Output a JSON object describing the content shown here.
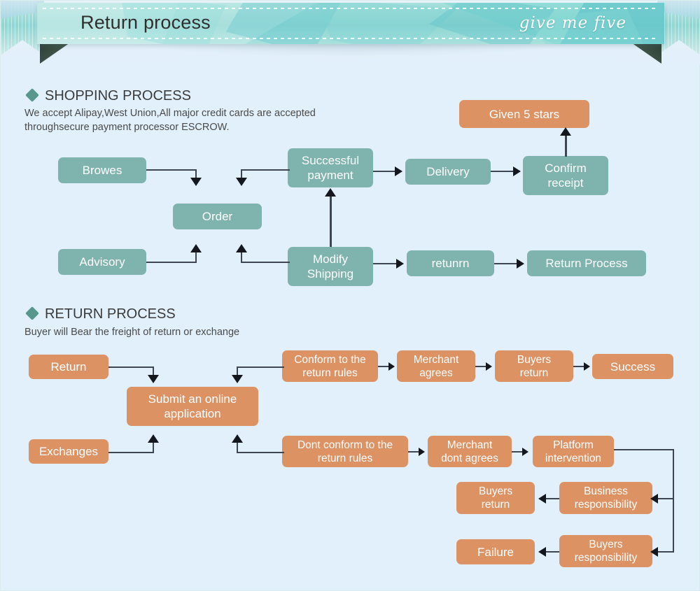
{
  "banner": {
    "title": "Return process",
    "script_text": "give me five",
    "band_color": "#8ed6d2"
  },
  "colors": {
    "background": "#e2f0fb",
    "teal_node": "#7fb3ad",
    "orange_node": "#dd9264",
    "diamond": "#57978c",
    "connector": "#3c4550"
  },
  "sections": [
    {
      "heading": "SHOPPING PROCESS",
      "subtitle": "We accept Alipay,West Union,All major credit cards are accepted\nthroughsecure payment processor ESCROW."
    },
    {
      "heading": "RETURN PROCESS",
      "subtitle": "Buyer will Bear the freight of return or exchange"
    }
  ],
  "shopping_nodes": {
    "browes": "Browes",
    "order": "Order",
    "advisory": "Advisory",
    "successful_payment": "Successful\npayment",
    "modify_shipping": "Modify\nShipping",
    "delivery": "Delivery",
    "confirm_receipt": "Confirm\nreceipt",
    "given_5_stars": "Given 5 stars",
    "returnrn": "retunrn",
    "return_process": "Return Process"
  },
  "return_nodes": {
    "return": "Return",
    "exchanges": "Exchanges",
    "submit_application": "Submit an online\napplication",
    "conform_rules": "Conform to the\nreturn rules",
    "merchant_agrees": "Merchant\nagrees",
    "buyers_return_top": "Buyers\nreturn",
    "success": "Success",
    "dont_conform_rules": "Dont conform to the\nreturn rules",
    "merchant_dont_agrees": "Merchant\ndont agrees",
    "platform_intervention": "Platform\nintervention",
    "business_responsibility": "Business\nresponsibility",
    "buyers_return_bottom": "Buyers\nreturn",
    "buyers_responsibility": "Buyers\nresponsibility",
    "failure": "Failure"
  }
}
